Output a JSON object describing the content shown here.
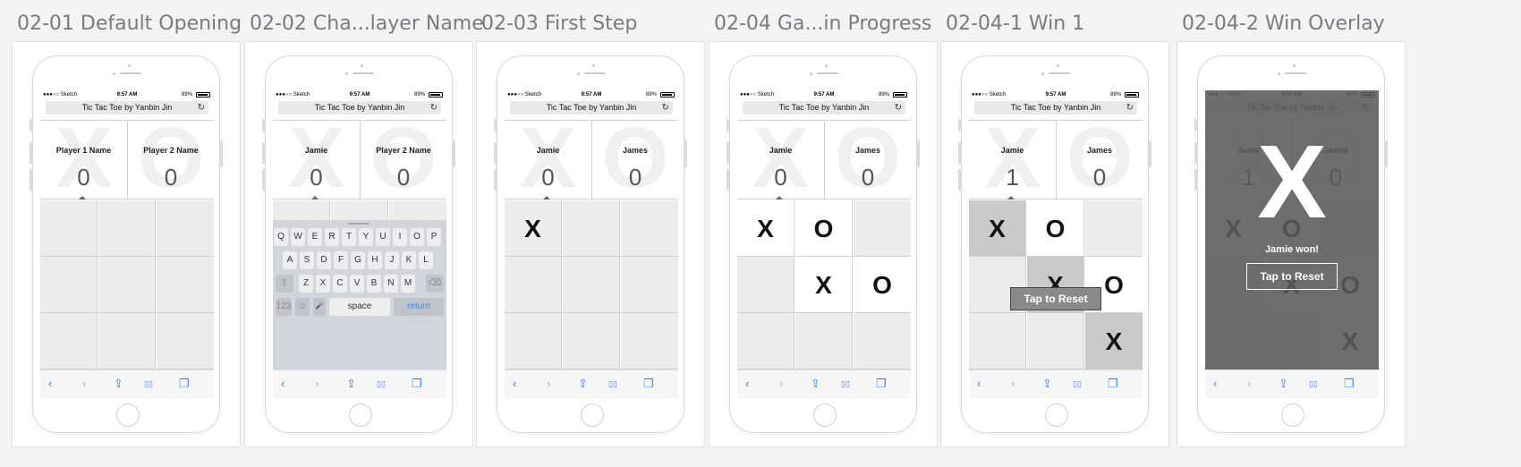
{
  "app": {
    "status_left": "●●●○○ Sketch",
    "status_time": "9:57 AM",
    "status_right": "89%",
    "url_title": "Tic Tac Toe by Yanbin Jin",
    "reload_icon": "↻",
    "bg_mark_left": "X",
    "bg_mark_right": "O",
    "toolbar": [
      "‹",
      "›",
      "⇪",
      "▯▯",
      "❐"
    ]
  },
  "artboards": [
    {
      "title": "02-01 Default Opening",
      "p1": "Player 1 Name",
      "p2": "Player 2 Name",
      "s1": "0",
      "s2": "0",
      "board": [
        "",
        "",
        "",
        "",
        "",
        "",
        "",
        "",
        ""
      ]
    },
    {
      "title": "02-02 Cha...layer Name",
      "p1": "Jamie",
      "p2": "Player 2 Name",
      "s1": "0",
      "s2": "0",
      "keyboard": {
        "row1": [
          "Q",
          "W",
          "E",
          "R",
          "T",
          "Y",
          "U",
          "I",
          "O",
          "P"
        ],
        "row2": [
          "A",
          "S",
          "D",
          "F",
          "G",
          "H",
          "J",
          "K",
          "L"
        ],
        "row3": [
          "Z",
          "X",
          "C",
          "V",
          "B",
          "N",
          "M"
        ],
        "shift": "⇧",
        "delete": "⌫",
        "numbers": "123",
        "emoji": "☺",
        "mic": "🎤",
        "space": "space",
        "return": "return"
      }
    },
    {
      "title": "02-03 First Step",
      "p1": "Jamie",
      "p2": "James",
      "s1": "0",
      "s2": "0",
      "board": [
        "X",
        "",
        "",
        "",
        "",
        "",
        "",
        "",
        ""
      ]
    },
    {
      "title": "02-04 Ga...in Progress",
      "p1": "Jamie",
      "p2": "James",
      "s1": "0",
      "s2": "0",
      "board": [
        "X",
        "O",
        "",
        "",
        "X",
        "O",
        "",
        "",
        ""
      ]
    },
    {
      "title": "02-04-1 Win 1",
      "p1": "Jamie",
      "p2": "James",
      "s1": "1",
      "s2": "0",
      "board": [
        "X",
        "O",
        "",
        "",
        "X",
        "O",
        "",
        "",
        "X"
      ],
      "reset_label": "Tap to Reset"
    },
    {
      "title": "02-04-2 Win Overlay",
      "p1": "Jamie",
      "p2": "James",
      "s1": "1",
      "s2": "0",
      "board": [
        "X",
        "O",
        "",
        "",
        "X",
        "O",
        "",
        "",
        "X"
      ],
      "overlay": {
        "mark": "X",
        "message": "Jamie won!",
        "button": "Tap to Reset"
      }
    }
  ]
}
